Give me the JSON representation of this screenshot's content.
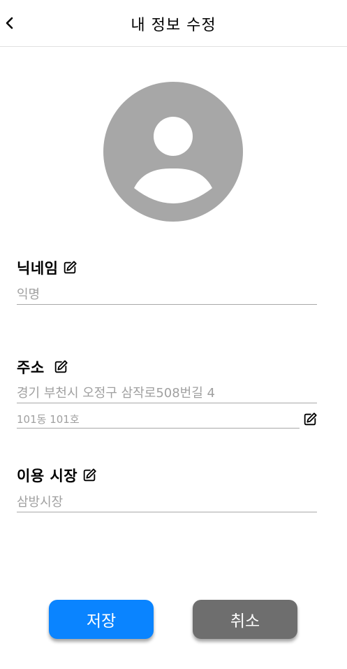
{
  "header": {
    "title": "내 정보 수정"
  },
  "nickname": {
    "label": "닉네임",
    "value": "익명"
  },
  "address": {
    "label": "주소",
    "line1": "경기 부천시 오정구 삼작로508번길 4",
    "line2": "101동 101호"
  },
  "market": {
    "label": "이용 시장",
    "value": "삼방시장"
  },
  "actions": {
    "save": "저장",
    "cancel": "취소"
  },
  "colors": {
    "save": "#0a84ff",
    "cancel": "#6e6e6e",
    "avatar": "#a7a7a7"
  }
}
